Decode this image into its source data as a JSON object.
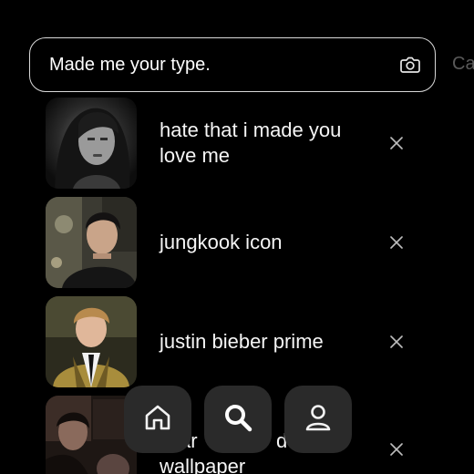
{
  "search": {
    "value": "Made me your type.",
    "placeholder": "",
    "cancel_label": "Ca",
    "camera_icon": "camera-icon"
  },
  "results": [
    {
      "label": "hate that i made you love me",
      "thumb": "black-and-white portrait"
    },
    {
      "label": "jungkook icon",
      "thumb": "person with dark hair"
    },
    {
      "label": "justin bieber prime",
      "thumb": "young man in gold jacket"
    },
    {
      "label": "…ar…d wallpaper",
      "label_visible_tail": "wallpaper",
      "thumb": "dark portrait collage"
    }
  ],
  "nav": {
    "items": [
      {
        "name": "home",
        "icon": "home-icon"
      },
      {
        "name": "search",
        "icon": "search-icon",
        "active": true
      },
      {
        "name": "profile",
        "icon": "profile-icon"
      }
    ]
  },
  "colors": {
    "background": "#000000",
    "search_border": "#d9d9d9",
    "nav_button": "#2a2a2a",
    "text": "#f5f5f5",
    "muted": "#5a5a5a"
  }
}
